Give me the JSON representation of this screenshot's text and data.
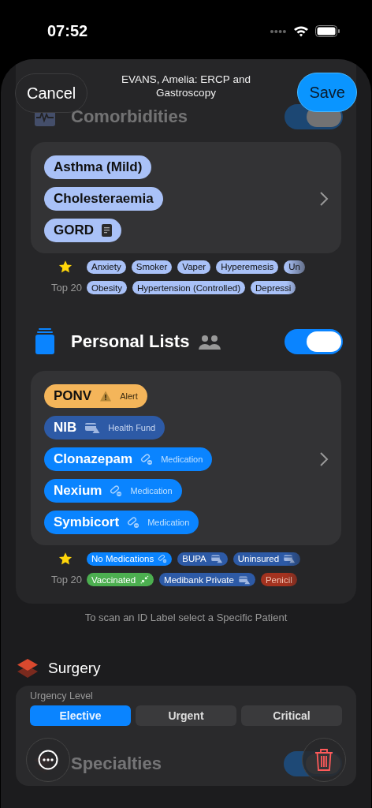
{
  "status_bar": {
    "time": "07:52"
  },
  "header": {
    "cancel": "Cancel",
    "title": "EVANS, Amelia: ERCP and Gastroscopy",
    "save": "Save"
  },
  "comorbidities": {
    "title": "Comorbidities",
    "on": true,
    "items": [
      {
        "label": "Asthma (Mild)",
        "kind": "condition",
        "note": false
      },
      {
        "label": "Cholesteraemia",
        "kind": "condition",
        "note": false
      },
      {
        "label": "GORD",
        "kind": "condition",
        "note": true
      }
    ],
    "quick_label": "Top 20",
    "quick_rows": [
      [
        {
          "label": "Anxiety",
          "kind": "condition"
        },
        {
          "label": "Smoker",
          "kind": "condition"
        },
        {
          "label": "Vaper",
          "kind": "condition"
        },
        {
          "label": "Hyperemesis",
          "kind": "condition"
        },
        {
          "label": "Un",
          "kind": "condition"
        }
      ],
      [
        {
          "label": "Obesity",
          "kind": "condition"
        },
        {
          "label": "Hypertension (Controlled)",
          "kind": "condition"
        },
        {
          "label": "Depressi",
          "kind": "condition"
        }
      ]
    ]
  },
  "personal_lists": {
    "title": "Personal Lists",
    "on": true,
    "items": [
      {
        "label": "PONV",
        "kind": "alert",
        "tag": "Alert"
      },
      {
        "label": "NIB",
        "kind": "fund",
        "tag": "Health Fund"
      },
      {
        "label": "Clonazepam",
        "kind": "medication",
        "tag": "Medication"
      },
      {
        "label": "Nexium",
        "kind": "medication",
        "tag": "Medication"
      },
      {
        "label": "Symbicort",
        "kind": "medication",
        "tag": "Medication"
      }
    ],
    "quick_label": "Top 20",
    "quick_rows": [
      [
        {
          "label": "No Medications",
          "kind": "medication"
        },
        {
          "label": "BUPA",
          "kind": "fund"
        },
        {
          "label": "Uninsured",
          "kind": "fund"
        }
      ],
      [
        {
          "label": "Vaccinated",
          "kind": "vaccine"
        },
        {
          "label": "Medibank Private",
          "kind": "fund"
        },
        {
          "label": "Penicil",
          "kind": "allergy"
        }
      ]
    ]
  },
  "scan_hint": "To scan an ID Label select a Specific Patient",
  "surgery": {
    "title": "Surgery",
    "urgency_label": "Urgency Level",
    "urgency": [
      {
        "label": "Elective",
        "selected": true
      },
      {
        "label": "Urgent",
        "selected": false
      },
      {
        "label": "Critical",
        "selected": false
      }
    ]
  },
  "specialties": {
    "title": "Specialties",
    "on": true
  }
}
